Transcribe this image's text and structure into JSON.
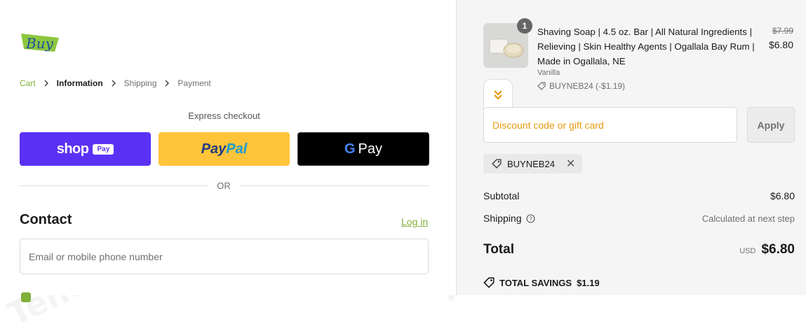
{
  "logo": {
    "text": "Buy",
    "bg_color": "#8dc63f",
    "text_color": "#1f4fa0"
  },
  "breadcrumb": [
    {
      "label": "Cart",
      "state": "link"
    },
    {
      "label": "Information",
      "state": "active"
    },
    {
      "label": "Shipping",
      "state": "inactive"
    },
    {
      "label": "Payment",
      "state": "inactive"
    }
  ],
  "express": {
    "label": "Express checkout",
    "shop_pay": {
      "text": "shop",
      "badge": "Pay",
      "color": "#5a31f4"
    },
    "paypal": {
      "part1": "Pay",
      "part2": "Pal",
      "color": "#ffc439"
    },
    "gpay": {
      "g": "G",
      "text": "Pay",
      "color": "#000000"
    },
    "or": "OR"
  },
  "contact": {
    "heading": "Contact",
    "login": "Log in",
    "email_placeholder": "Email or mobile phone number"
  },
  "order": {
    "item": {
      "quantity": "1",
      "title": "Shaving Soap | 4.5 oz. Bar | All Natural Ingredients | Relieving | Skin Healthy Agents | Ogallala Bay Rum | Made in Ogallala, NE",
      "variant": "Vanilla",
      "discount": "BUYNEB24 (-$1.19)",
      "price_old": "$7.99",
      "price_new": "$6.80"
    },
    "discount_placeholder": "Discount code or gift card",
    "apply_label": "Apply",
    "applied_code": "BUYNEB24",
    "subtotal": {
      "label": "Subtotal",
      "value": "$6.80"
    },
    "shipping": {
      "label": "Shipping",
      "value": "Calculated at next step"
    },
    "total": {
      "label": "Total",
      "currency": "USD",
      "value": "$6.80"
    },
    "savings": {
      "label": "TOTAL SAVINGS",
      "value": "$1.19"
    }
  },
  "watermark": "Tenereteam",
  "colors": {
    "accent": "#7fb03a",
    "sidebar_bg": "#f5f5f5"
  }
}
